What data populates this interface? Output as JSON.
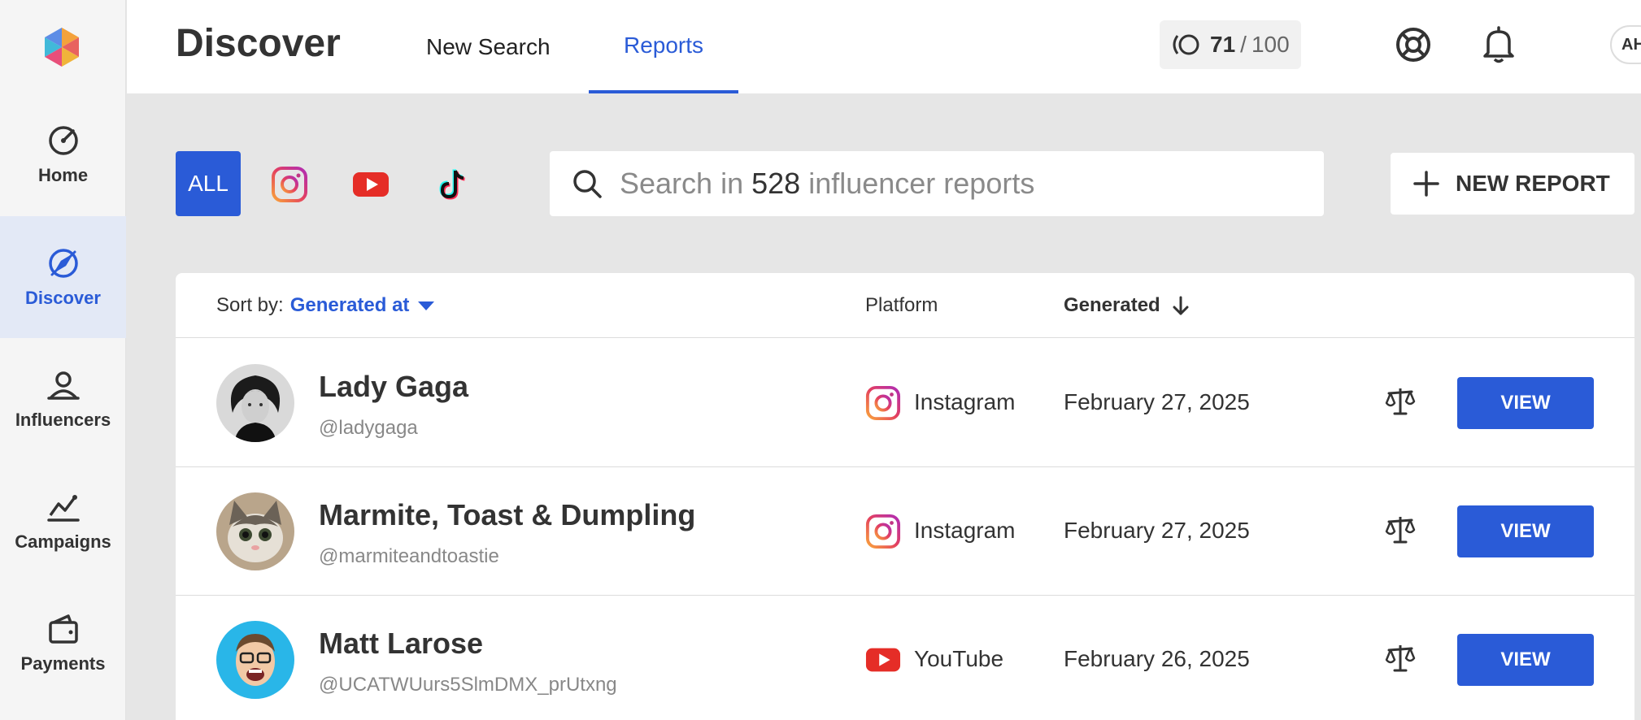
{
  "sidebar": {
    "items": [
      {
        "label": "Home",
        "icon": "gauge-icon",
        "active": false
      },
      {
        "label": "Discover",
        "icon": "compass-icon",
        "active": true
      },
      {
        "label": "Influencers",
        "icon": "user-icon",
        "active": false
      },
      {
        "label": "Campaigns",
        "icon": "chart-icon",
        "active": false
      },
      {
        "label": "Payments",
        "icon": "wallet-icon",
        "active": false
      }
    ]
  },
  "header": {
    "title": "Discover",
    "tabs": [
      {
        "label": "New Search",
        "active": false
      },
      {
        "label": "Reports",
        "active": true
      }
    ],
    "credits": {
      "used": "71",
      "separator": "/",
      "total": "100"
    },
    "user_initials": "AH"
  },
  "filters": {
    "all_label": "ALL",
    "platforms": [
      "instagram-icon",
      "youtube-icon",
      "tiktok-icon"
    ]
  },
  "search": {
    "prefix": "Search in",
    "count": "528",
    "suffix": "influencer reports"
  },
  "new_report_label": "NEW REPORT",
  "table": {
    "sort_by_label": "Sort by:",
    "sort_value": "Generated at",
    "col_platform": "Platform",
    "col_generated": "Generated",
    "rows": [
      {
        "name": "Lady Gaga",
        "handle": "@ladygaga",
        "platform": "Instagram",
        "date": "February 27, 2025",
        "view_label": "VIEW"
      },
      {
        "name": "Marmite, Toast & Dumpling",
        "handle": "@marmiteandtoastie",
        "platform": "Instagram",
        "date": "February 27, 2025",
        "view_label": "VIEW"
      },
      {
        "name": "Matt Larose",
        "handle": "@UCATWUurs5SlmDMX_prUtxng",
        "platform": "YouTube",
        "date": "February 26, 2025",
        "view_label": "VIEW"
      }
    ]
  },
  "colors": {
    "accent": "#2a5bd7",
    "youtube": "#e52d27"
  }
}
